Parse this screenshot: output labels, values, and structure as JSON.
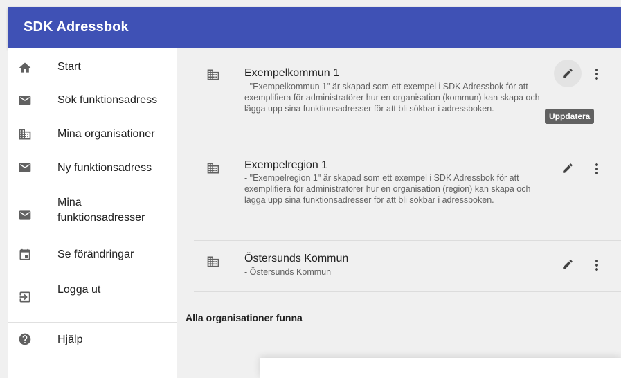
{
  "app": {
    "title": "SDK Adressbok",
    "accent": "#3f51b5"
  },
  "sidebar": {
    "items": [
      {
        "label": "Start",
        "icon": "home-icon"
      },
      {
        "label": "Sök funktionsadress",
        "icon": "mail-icon"
      },
      {
        "label": "Mina organisationer",
        "icon": "building-icon"
      },
      {
        "label": "Ny funktionsadress",
        "icon": "mail-icon"
      },
      {
        "label": "Mina funktionsadresser",
        "icon": "mail-icon"
      },
      {
        "label": "Se förändringar",
        "icon": "calendar-icon"
      },
      {
        "label": "Logga ut",
        "icon": "logout-icon"
      },
      {
        "label": "Hjälp",
        "icon": "help-icon"
      }
    ]
  },
  "organizations": [
    {
      "name": "Exempelkommun 1",
      "description": " - \"Exempelkommun 1\" är skapad som ett exempel i SDK Adressbok för att exemplifiera för administratörer hur en organisation (kommun) kan skapa och lägga upp sina funktionsadresser för att bli sökbar i adressboken."
    },
    {
      "name": "Exempelregion 1",
      "description": " - \"Exempelregion 1\" är skapad som ett exempel i SDK Adressbok för att exemplifiera för administratörer hur en organisation (region) kan skapa och lägga upp sina funktionsadresser för att bli sökbar i adressboken."
    },
    {
      "name": "Östersunds Kommun",
      "description": " - Östersunds Kommun"
    }
  ],
  "tooltip": {
    "text": "Uppdatera"
  },
  "summary": {
    "text": "Alla organisationer funna"
  }
}
